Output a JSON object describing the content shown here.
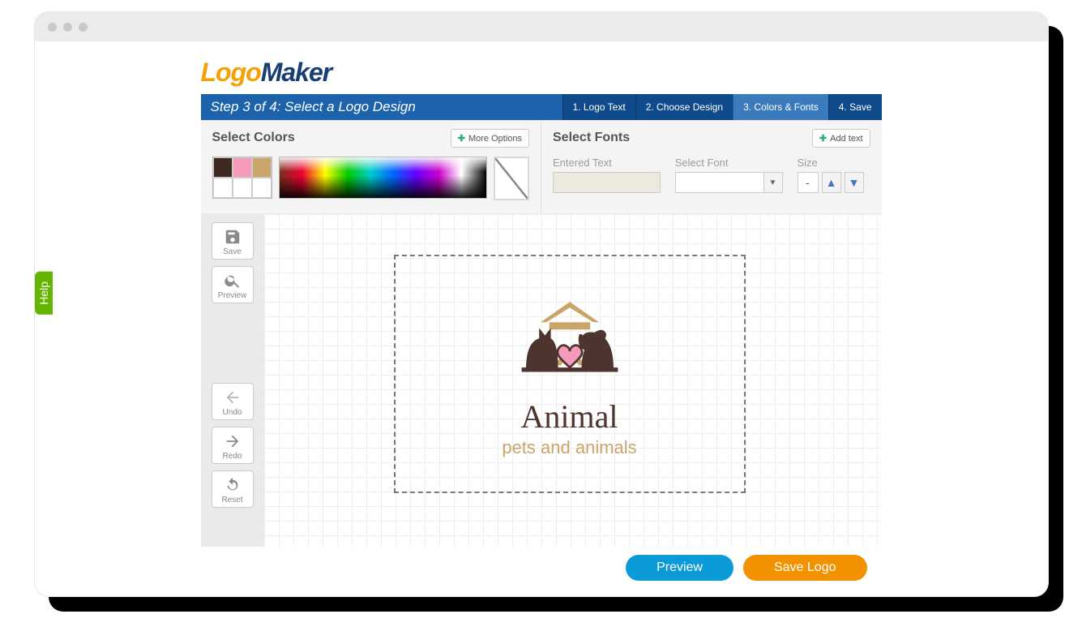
{
  "help_tab": "Help",
  "brand": {
    "part1": "Logo",
    "part2": "Maker"
  },
  "stepbar": {
    "title": "Step 3 of 4: Select a Logo Design",
    "tabs": [
      "1. Logo Text",
      "2. Choose Design",
      "3. Colors & Fonts",
      "4. Save"
    ],
    "active_index": 2
  },
  "panels": {
    "colors": {
      "heading": "Select Colors",
      "more_btn": "More Options",
      "swatches": [
        "#3e2a20",
        "#f59bb9",
        "#c9a56c",
        "#ffffff",
        "#ffffff",
        "#ffffff"
      ]
    },
    "fonts": {
      "heading": "Select Fonts",
      "add_btn": "Add text",
      "labels": {
        "entered": "Entered Text",
        "font": "Select Font",
        "size": "Size"
      },
      "entered_value": "",
      "font_value": "",
      "size_value": "-"
    }
  },
  "toolbar": {
    "save": "Save",
    "preview": "Preview",
    "undo": "Undo",
    "redo": "Redo",
    "reset": "Reset"
  },
  "logo": {
    "title": "Animal",
    "subtitle": "pets and animals"
  },
  "footer": {
    "preview": "Preview",
    "save": "Save Logo"
  }
}
